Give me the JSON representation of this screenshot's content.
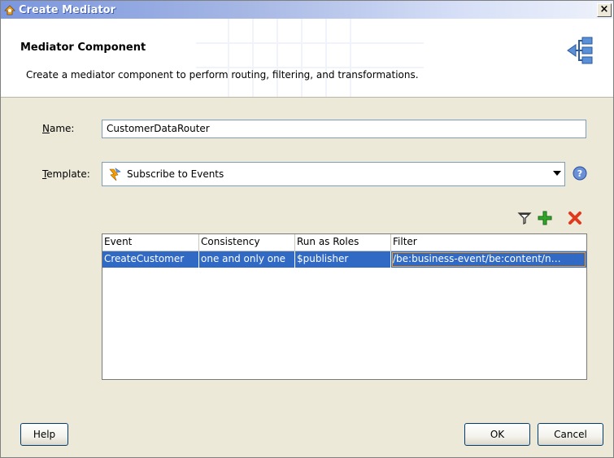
{
  "window": {
    "title": "Create Mediator",
    "close_label": "×"
  },
  "header": {
    "title": "Mediator Component",
    "description": "Create a mediator component to perform routing, filtering, and transformations."
  },
  "form": {
    "name_label_mnemonic": "N",
    "name_label_rest": "ame:",
    "name_value": "CustomerDataRouter",
    "template_label_mnemonic": "T",
    "template_label_rest": "emplate:",
    "template_value": "Subscribe to Events"
  },
  "toolbar": {
    "icons": [
      "filter-icon",
      "add-icon",
      "delete-icon"
    ]
  },
  "table": {
    "columns": [
      "Event",
      "Consistency",
      "Run as Roles",
      "Filter"
    ],
    "rows": [
      {
        "event": "CreateCustomer",
        "consistency": "one and only one",
        "run_as_roles": "$publisher",
        "filter": "/be:business-event/be:content/n…"
      }
    ]
  },
  "buttons": {
    "help": "Help",
    "ok": "OK",
    "cancel": "Cancel"
  },
  "colors": {
    "selection": "#316ac5",
    "dialog_bg": "#ece9d8",
    "delete_red": "#e03a1e",
    "add_green": "#2fa52a"
  }
}
